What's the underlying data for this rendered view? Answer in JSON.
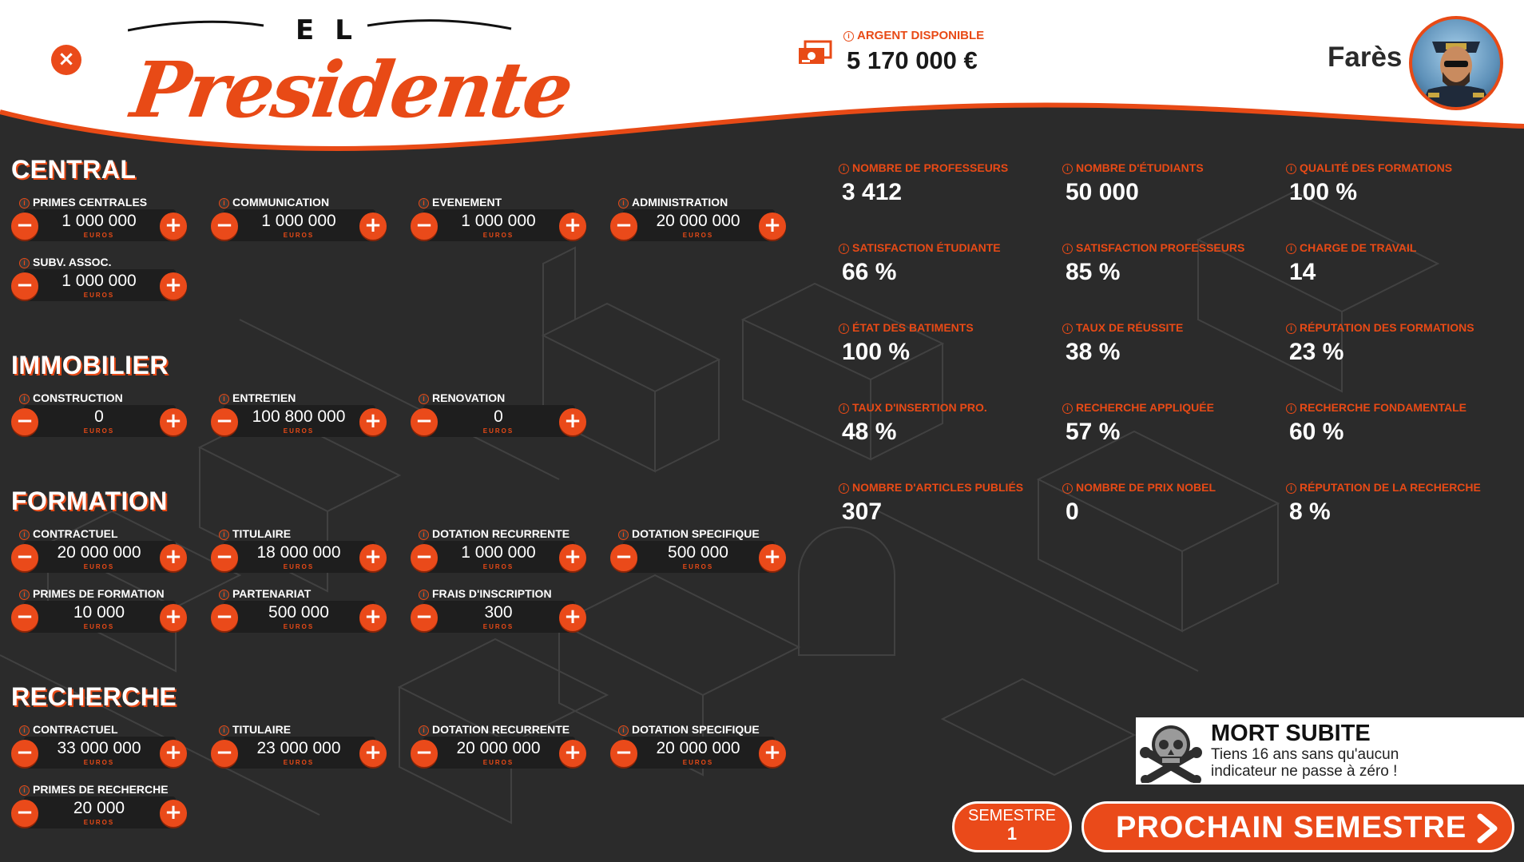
{
  "header": {
    "close_glyph": "×",
    "logo_top": "EL",
    "logo_word": "Presidente",
    "money_label": "ARGENT DISPONIBLE",
    "money_value": "5 170 000 €",
    "user_name": "Farès"
  },
  "unit_label": "EUROS",
  "sections": {
    "central": {
      "title": "CENTRAL",
      "items": [
        {
          "label": "PRIMES CENTRALES",
          "value": "1 000 000"
        },
        {
          "label": "COMMUNICATION",
          "value": "1 000 000"
        },
        {
          "label": "EVENEMENT",
          "value": "1 000 000"
        },
        {
          "label": "ADMINISTRATION",
          "value": "20 000 000"
        },
        {
          "label": "SUBV. ASSOC.",
          "value": "1 000 000"
        }
      ]
    },
    "immobilier": {
      "title": "IMMOBILIER",
      "items": [
        {
          "label": "CONSTRUCTION",
          "value": "0"
        },
        {
          "label": "ENTRETIEN",
          "value": "100 800 000"
        },
        {
          "label": "RENOVATION",
          "value": "0"
        }
      ]
    },
    "formation": {
      "title": "FORMATION",
      "items": [
        {
          "label": "CONTRACTUEL",
          "value": "20 000 000"
        },
        {
          "label": "TITULAIRE",
          "value": "18 000 000"
        },
        {
          "label": "DOTATION RECURRENTE",
          "value": "1 000 000"
        },
        {
          "label": "DOTATION SPECIFIQUE",
          "value": "500 000"
        },
        {
          "label": "PRIMES DE FORMATION",
          "value": "10 000"
        },
        {
          "label": "PARTENARIAT",
          "value": "500 000"
        },
        {
          "label": "FRAIS D'INSCRIPTION",
          "value": "300"
        }
      ]
    },
    "recherche": {
      "title": "RECHERCHE",
      "items": [
        {
          "label": "CONTRACTUEL",
          "value": "33 000 000"
        },
        {
          "label": "TITULAIRE",
          "value": "23 000 000"
        },
        {
          "label": "DOTATION RECURRENTE",
          "value": "20 000 000"
        },
        {
          "label": "DOTATION SPECIFIQUE",
          "value": "20 000 000"
        },
        {
          "label": "PRIMES DE RECHERCHE",
          "value": "20 000"
        }
      ]
    }
  },
  "stats": [
    {
      "label": "NOMBRE DE PROFESSEURS",
      "value": "3 412"
    },
    {
      "label": "NOMBRE D'ÉTUDIANTS",
      "value": "50 000"
    },
    {
      "label": "QUALITÉ DES FORMATIONS",
      "value": "100 %"
    },
    {
      "label": "SATISFACTION ÉTUDIANTE",
      "value": "66 %"
    },
    {
      "label": "SATISFACTION PROFESSEURS",
      "value": "85 %"
    },
    {
      "label": "CHARGE DE TRAVAIL",
      "value": "14"
    },
    {
      "label": "ÉTAT DES BATIMENTS",
      "value": "100 %"
    },
    {
      "label": "TAUX DE RÉUSSITE",
      "value": "38 %"
    },
    {
      "label": "RÉPUTATION DES FORMATIONS",
      "value": "23 %"
    },
    {
      "label": "TAUX D'INSERTION PRO.",
      "value": "48 %"
    },
    {
      "label": "RECHERCHE APPLIQUÉE",
      "value": "57 %"
    },
    {
      "label": "RECHERCHE FONDAMENTALE",
      "value": "60 %"
    },
    {
      "label": "NOMBRE D'ARTICLES PUBLIÉS",
      "value": "307"
    },
    {
      "label": "NOMBRE DE PRIX NOBEL",
      "value": "0"
    },
    {
      "label": "RÉPUTATION DE LA RECHERCHE",
      "value": "8 %"
    }
  ],
  "toast": {
    "title": "MORT SUBITE",
    "description": "Tiens 16 ans sans qu'aucun indicateur ne passe à zéro !"
  },
  "footer": {
    "semester_label": "SEMESTRE",
    "semester_number": "1",
    "next_label": "PROCHAIN SEMESTRE"
  },
  "colors": {
    "accent": "#e84a16",
    "background": "#2b2b2b",
    "header_bg": "#ffffff"
  }
}
